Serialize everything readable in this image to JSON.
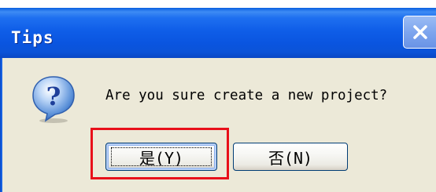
{
  "window": {
    "title": "Tips"
  },
  "dialog": {
    "message": "Are you sure create a new project?",
    "icon": "question-icon"
  },
  "buttons": {
    "yes_label": "是(Y)",
    "no_label": "否(N)"
  },
  "colors": {
    "titlebar": "#0a55e0",
    "body": "#ece9d8",
    "highlight": "#e8101a"
  }
}
